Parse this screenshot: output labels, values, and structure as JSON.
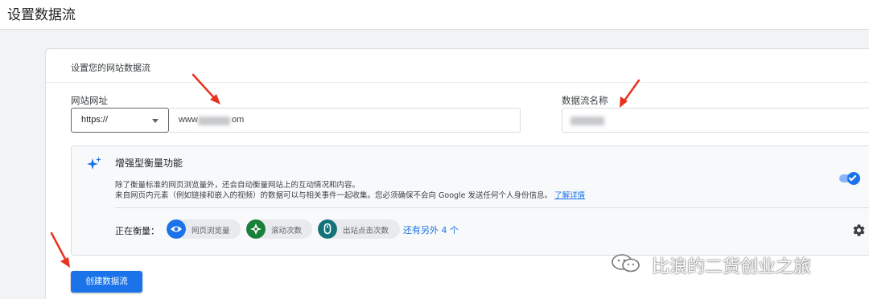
{
  "page": {
    "title": "设置数据流"
  },
  "card": {
    "title": "设置您的网站数据流"
  },
  "website_url": {
    "label": "网站网址",
    "protocol": "https://",
    "value_prefix": "www",
    "value_suffix": "om"
  },
  "stream_name": {
    "label": "数据流名称"
  },
  "enhanced_measurement": {
    "icon": "sparkle-icon",
    "title": "增强型衡量功能",
    "description_line1": "除了衡量标准的网页浏览量外，还会自动衡量网站上的互动情况和内容。",
    "description_line2": "来自网页内元素（例如链接和嵌入的视频）的数据可以与相关事件一起收集。您必须确保不会向 Google 发送任何个人身份信息。",
    "learn_more": "了解详情",
    "enabled": true,
    "measuring_label": "正在衡量：",
    "events": [
      {
        "label": "网页浏览量",
        "icon": "eye-icon",
        "color": "#1a73e8"
      },
      {
        "label": "滚动次数",
        "icon": "compass-icon",
        "color": "#188038"
      },
      {
        "label": "出站点击次数",
        "icon": "mouse-icon",
        "color": "#12737a"
      }
    ],
    "more_link": "还有另外 4 个"
  },
  "actions": {
    "create_button": "创建数据流"
  },
  "watermark": {
    "text": "比浪的二货创业之旅"
  },
  "colors": {
    "accent": "#1a73e8",
    "annotation_arrow": "#e8321e"
  }
}
